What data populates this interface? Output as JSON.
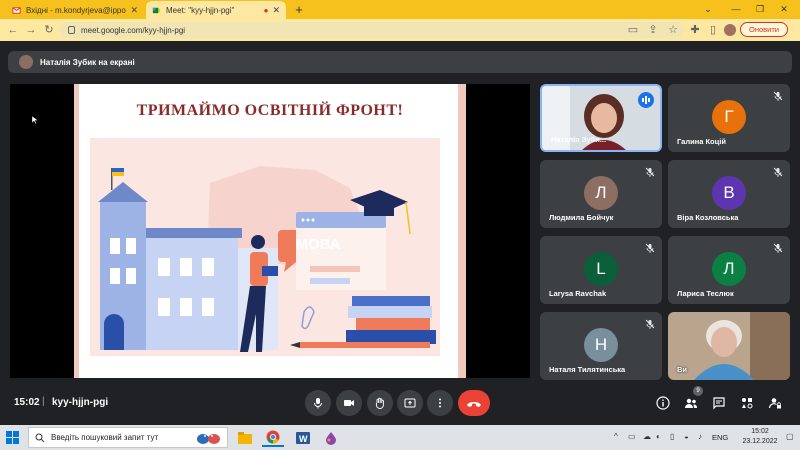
{
  "browser": {
    "tabs": [
      {
        "title": "Вхідні - m.kondyrjeva@ippo.edu",
        "icon": "gmail-icon"
      },
      {
        "title": "Meet: \"kyy-hjjn-pgi\"",
        "icon": "meet-icon"
      }
    ],
    "url": "meet.google.com/kyy-hjjn-pgi",
    "update_label": "Оновити"
  },
  "meet": {
    "presenter_banner": "Наталія Зубик на екрані",
    "slide": {
      "title": "ТРИМАЙМО ОСВІТНІЙ ФРОНТ!",
      "badge": "МОВА"
    },
    "participants": [
      {
        "name": "Наталія Зуби...",
        "initial": "",
        "color": "#8d6e63",
        "video": true,
        "speaking": true
      },
      {
        "name": "Галина Коцій",
        "initial": "Г",
        "color": "#e8710a",
        "muted": true
      },
      {
        "name": "Людмила Бойчук",
        "initial": "Л",
        "color": "#8d6e63",
        "muted": true
      },
      {
        "name": "Віра Козловська",
        "initial": "В",
        "color": "#5e35b1",
        "muted": true
      },
      {
        "name": "Larysa Ravchak",
        "initial": "L",
        "color": "#0b5e3a",
        "muted": true
      },
      {
        "name": "Лариса Теслюк",
        "initial": "Л",
        "color": "#0b8043",
        "muted": true
      },
      {
        "name": "Наталя Тилятинська",
        "initial": "Н",
        "color": "#78909c",
        "muted": true
      },
      {
        "name": "Ви",
        "initial": "",
        "color": "#6d8a9c",
        "video": true
      }
    ],
    "time": "15:02",
    "meeting_code": "kyy-hjjn-pgi",
    "people_count": "9"
  },
  "taskbar": {
    "search_placeholder": "Введіть пошуковий запит тут",
    "language": "ENG",
    "clock_time": "15:02",
    "clock_date": "23.12.2022"
  }
}
